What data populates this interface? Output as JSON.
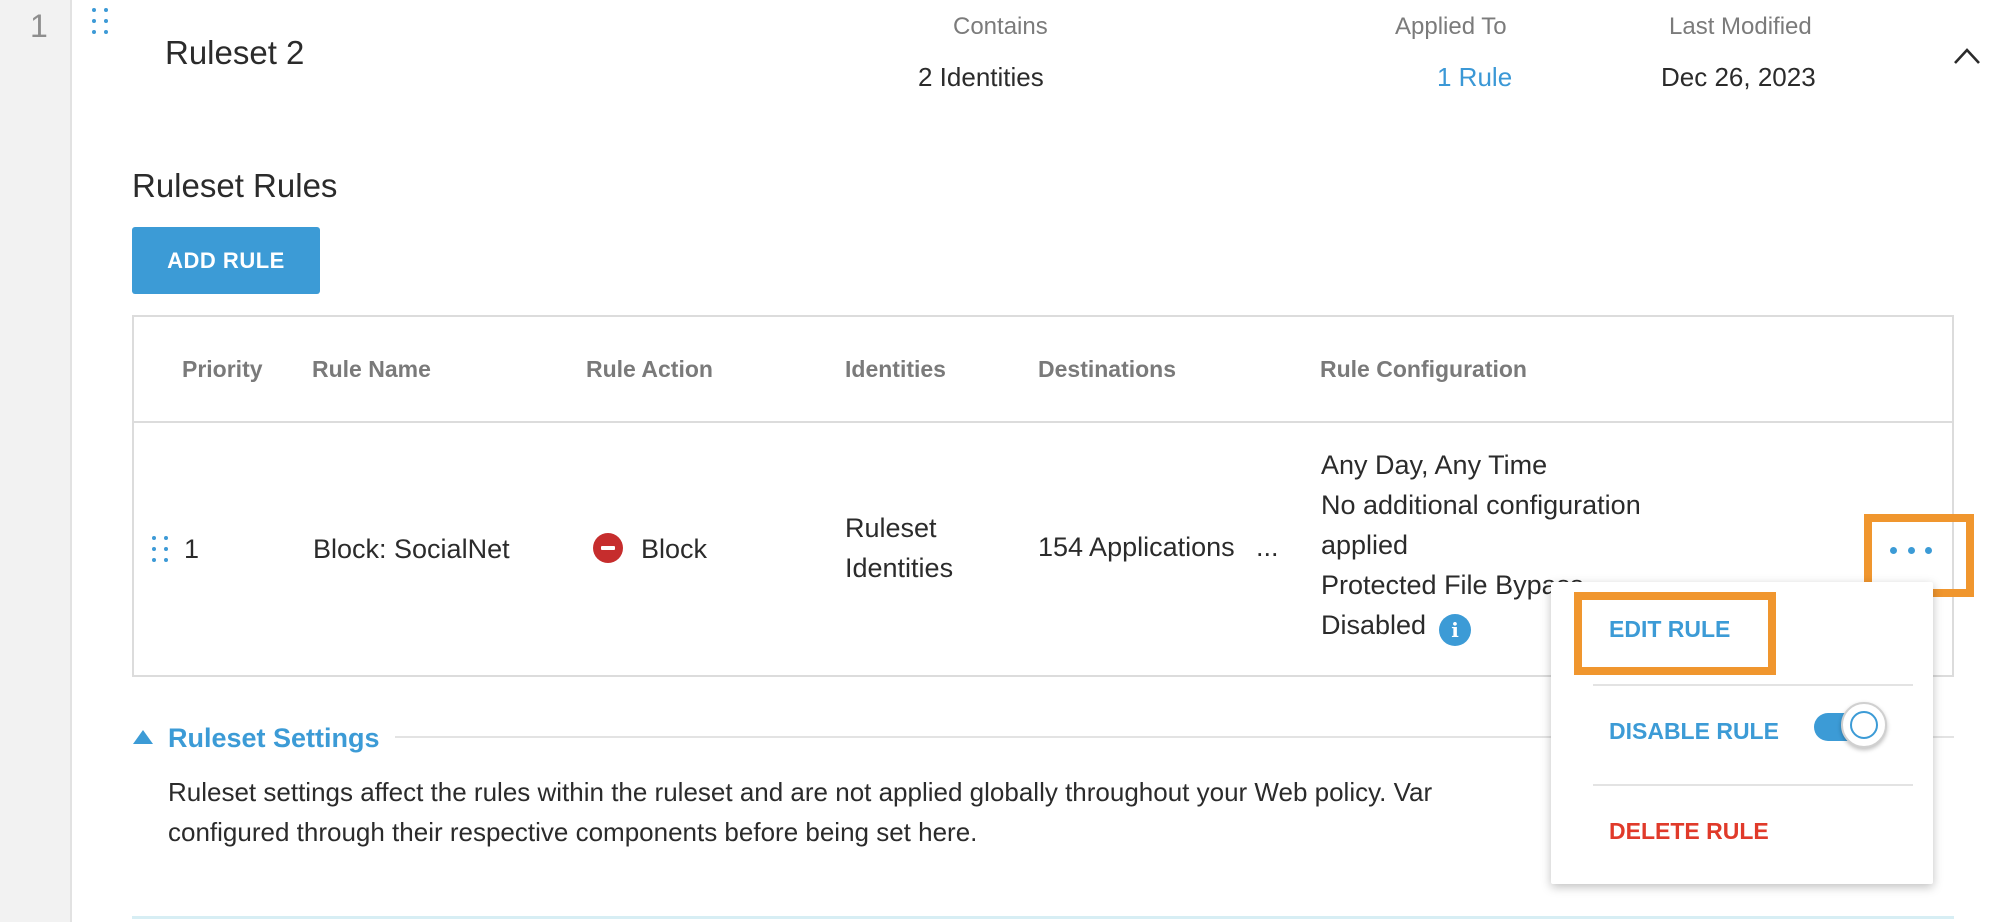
{
  "row_number": "1",
  "ruleset": {
    "name": "Ruleset 2",
    "contains_label": "Contains",
    "contains_value": "2 Identities",
    "applied_to_label": "Applied To",
    "applied_to_value": "1 Rule",
    "last_modified_label": "Last Modified",
    "last_modified_value": "Dec 26, 2023",
    "collapse_icon": "chevron-up-icon"
  },
  "rules_section": {
    "title": "Ruleset Rules",
    "add_rule_label": "ADD RULE"
  },
  "table": {
    "headers": {
      "priority": "Priority",
      "rule_name": "Rule Name",
      "rule_action": "Rule Action",
      "identities": "Identities",
      "destinations": "Destinations",
      "rule_configuration": "Rule Configuration"
    },
    "rows": [
      {
        "priority": "1",
        "rule_name": "Block: SocialNet",
        "rule_action": "Block",
        "identities_line1": "Ruleset",
        "identities_line2": "Identities",
        "destinations": "154 Applications",
        "destinations_more": "...",
        "config_line1": "Any Day, Any Time",
        "config_line2": "No additional configuration",
        "config_line3": "applied",
        "config_line4": "Protected File Bypass",
        "config_line5": "Disabled",
        "info_glyph": "i"
      }
    ]
  },
  "menu": {
    "edit_label": "EDIT RULE",
    "disable_label": "DISABLE RULE",
    "disable_toggle_on": true,
    "delete_label": "DELETE RULE"
  },
  "settings": {
    "title": "Ruleset Settings",
    "description_line1": "Ruleset settings affect the rules within the ruleset and are not applied globally throughout your Web policy. Var",
    "description_line2": "configured through their respective components before being set here."
  },
  "colors": {
    "accent": "#3c9bd6",
    "highlight": "#f0962e",
    "danger": "#e03a2a",
    "block_icon": "#c62d2d"
  }
}
